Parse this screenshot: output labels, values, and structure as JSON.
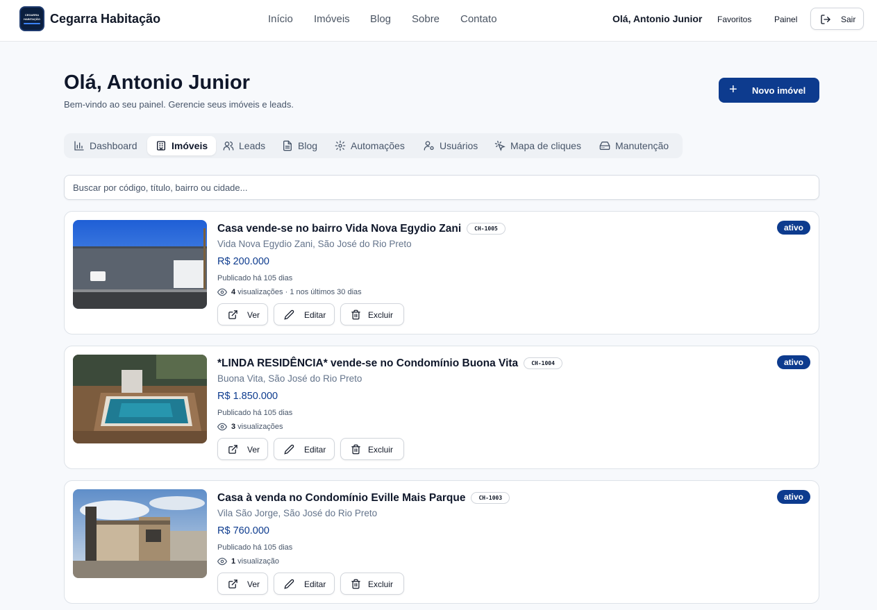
{
  "header": {
    "logo_text": "CEGARRA HABITAÇÃO",
    "brand": "Cegarra Habitação",
    "nav": [
      "Início",
      "Imóveis",
      "Blog",
      "Sobre",
      "Contato"
    ],
    "greeting": "Olá, Antonio Junior",
    "favoritos": "Favoritos",
    "painel": "Painel",
    "sair": "Sair"
  },
  "page": {
    "title": "Olá, Antonio Junior",
    "subtitle": "Bem-vindo ao seu painel. Gerencie seus imóveis e leads.",
    "new_button": "Novo imóvel",
    "new_plus": "+"
  },
  "tabs": [
    {
      "label": "Dashboard",
      "icon": "bar-chart-icon"
    },
    {
      "label": "Imóveis",
      "icon": "building-icon",
      "active": true
    },
    {
      "label": "Leads",
      "icon": "users-icon"
    },
    {
      "label": "Blog",
      "icon": "file-text-icon"
    },
    {
      "label": "Automações",
      "icon": "gear-icon"
    },
    {
      "label": "Usuários",
      "icon": "user-cog-icon"
    },
    {
      "label": "Mapa de cliques",
      "icon": "pointer-click-icon"
    },
    {
      "label": "Manutenção",
      "icon": "hard-drive-icon"
    }
  ],
  "search": {
    "placeholder": "Buscar por código, título, bairro ou cidade..."
  },
  "actions": {
    "view": "Ver",
    "edit": "Editar",
    "delete": "Excluir"
  },
  "listings": [
    {
      "title": "Casa vende-se no bairro Vida Nova Egydio Zani",
      "code": "CH-1005",
      "location": "Vida Nova Egydio Zani, São José do Rio Preto",
      "price": "R$ 200.000",
      "published": "Publicado há 105 dias",
      "views_count": "4",
      "views_text": "visualizações · 1 nos últimos 30 dias",
      "status": "ativo"
    },
    {
      "title": "*LINDA RESIDÊNCIA* vende-se no Condomínio Buona Vita",
      "code": "CH-1004",
      "location": "Buona Vita, São José do Rio Preto",
      "price": "R$ 1.850.000",
      "published": "Publicado há 105 dias",
      "views_count": "3",
      "views_text": "visualizações",
      "status": "ativo"
    },
    {
      "title": "Casa à venda no Condomínio Eville Mais Parque",
      "code": "CH-1003",
      "location": "Vila São Jorge, São José do Rio Preto",
      "price": "R$ 760.000",
      "published": "Publicado há 105 dias",
      "views_count": "1",
      "views_text": "visualização",
      "status": "ativo"
    }
  ]
}
